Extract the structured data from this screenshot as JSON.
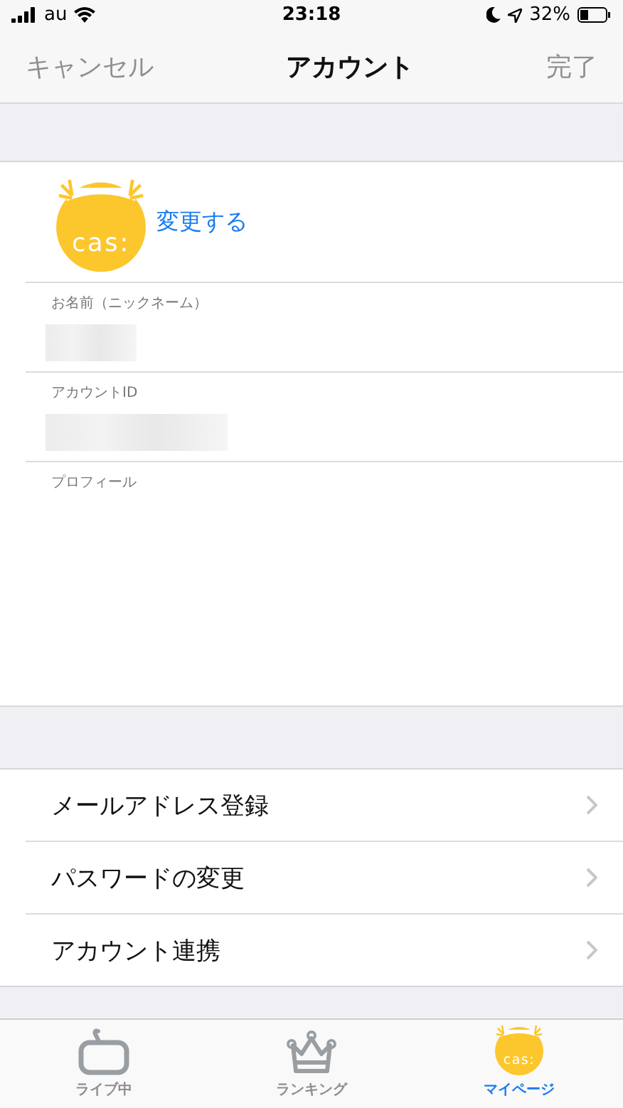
{
  "status_bar": {
    "carrier": "au",
    "time": "23:18",
    "battery": "32%"
  },
  "nav": {
    "cancel": "キャンセル",
    "title": "アカウント",
    "done": "完了"
  },
  "avatar": {
    "logo_text": "cas:",
    "change_link": "変更する"
  },
  "fields": [
    {
      "label": "お名前（ニックネーム）",
      "kind": "short"
    },
    {
      "label": "アカウントID",
      "kind": "long"
    },
    {
      "label": "プロフィール",
      "kind": "area"
    }
  ],
  "menu": [
    "メールアドレス登録",
    "パスワードの変更",
    "アカウント連携"
  ],
  "tabs": [
    {
      "label": "ライブ中",
      "kind": "tv",
      "selected": false
    },
    {
      "label": "ランキング",
      "kind": "crown",
      "selected": false
    },
    {
      "label": "マイページ",
      "kind": "logo",
      "logo_text": "cas:",
      "selected": true
    }
  ]
}
